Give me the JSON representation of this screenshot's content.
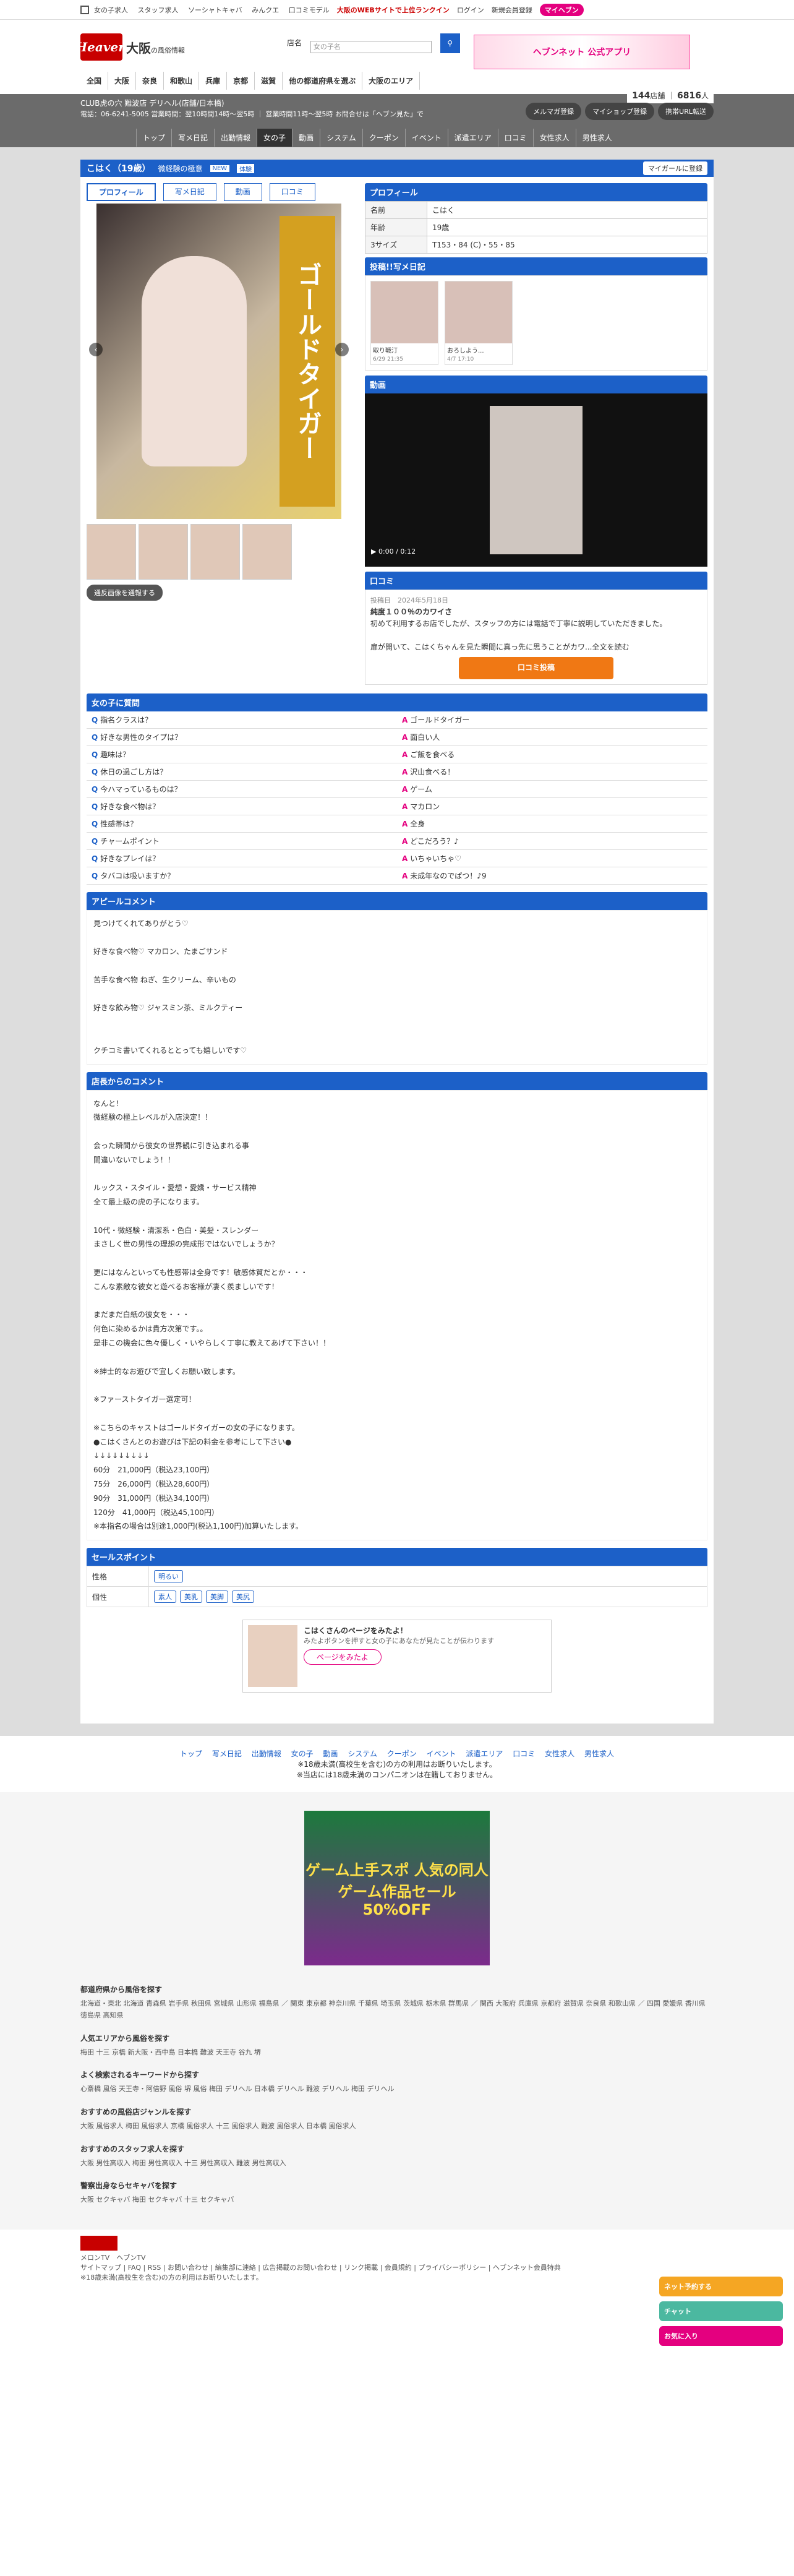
{
  "topbar": {
    "links": [
      "女の子求人",
      "スタッフ求人",
      "ソーシャトキャバ",
      "みんクエ",
      "口コミモデル"
    ],
    "right1": "大阪のWEBサイトで上位ランクイン",
    "login": "ログイン",
    "register": "新規会員登録",
    "my": "マイヘブン"
  },
  "header": {
    "logo": "Heaven",
    "pref": "大阪",
    "pref_sub": "の風俗情報",
    "search_label": "店名",
    "search_placeholder": "女の子名",
    "banner": "ヘブンネット 公式アプリ",
    "areas": [
      "全国",
      "大阪",
      "奈良",
      "和歌山",
      "兵庫",
      "京都",
      "滋賀",
      "他の都道府県を選ぶ",
      "大阪のエリア"
    ]
  },
  "shop": {
    "name": "CLUB虎の穴 難波店 デリヘル(店舗/日本橋)",
    "info": "電話：06-6241-5005 営業時間：翌10時間14時〜翌5時 ｜ 営業時間11時〜翌5時 お問合せは「ヘブン見た」で",
    "counts_a": "144",
    "counts_a_unit": "店舗",
    "counts_b": "6816",
    "counts_b_unit": "人",
    "btns": [
      "メルマガ登録",
      "マイショップ登録",
      "携帯URL転送"
    ],
    "nav": [
      "トップ",
      "写メ日記",
      "出勤情報",
      "女の子",
      "動画",
      "システム",
      "クーポン",
      "イベント",
      "派遣エリア",
      "口コミ",
      "女性求人",
      "男性求人"
    ]
  },
  "girl": {
    "title": "こはく（19歳）",
    "catch": "微経験の極意",
    "badge1": "NEW",
    "badge2": "体験",
    "fav": "マイガールに登録",
    "tabs": [
      "プロフィール",
      "写メ日記",
      "動画",
      "口コミ"
    ],
    "photo_text": "ゴールドタイガー",
    "trbtn": "通反画像を通報する"
  },
  "profile": {
    "title": "プロフィール",
    "rows": [
      [
        "名前",
        "こはく"
      ],
      [
        "年齢",
        "19歳"
      ],
      [
        "3サイズ",
        "T153・84 (C)・55・85"
      ]
    ]
  },
  "posts": {
    "title": "投稿!!写メ日記",
    "items": [
      {
        "t": "取り戦汀",
        "d": "6/29 21:35"
      },
      {
        "t": "おろしよう...",
        "d": "4/7 17:10"
      }
    ]
  },
  "video": {
    "title": "動画",
    "time": "0:00 / 0:12"
  },
  "review": {
    "title": "口コミ",
    "meta1": "投稿日",
    "meta2": "2024年5月18日",
    "head": "純度１００％のカワイさ",
    "body": "初めて利用するお店でしたが、スタッフの方には電話で丁寧に説明していただきました。\n\n扉が開いて、こはくちゃんを見た瞬間に真っ先に思うことがカワ...全文を読む",
    "btn": "口コミ投稿"
  },
  "qa": {
    "title": "女の子に質問",
    "items": [
      [
        "指名クラスは？",
        "ゴールドタイガー"
      ],
      [
        "好きな男性のタイプは？",
        "面白い人"
      ],
      [
        "趣味は？",
        "ご飯を食べる"
      ],
      [
        "休日の過ごし方は？",
        "沢山食べる！"
      ],
      [
        "今ハマっているものは？",
        "ゲーム"
      ],
      [
        "好きな食べ物は？",
        "マカロン"
      ],
      [
        "性感帯は？",
        "全身"
      ],
      [
        "チャームポイント",
        "どこだろう？♪"
      ],
      [
        "好きなプレイは？",
        "いちゃいちゃ♡"
      ],
      [
        "タバコは吸いますか？",
        "未成年なのでぱつ！♪9"
      ]
    ]
  },
  "appeal": {
    "title": "アピールコメント",
    "body": "見つけてくれてありがとう♡\n\n好きな食べ物♡ マカロン、たまごサンド\n\n苦手な食べ物 ねぎ、生クリーム、辛いもの\n\n好きな飲み物♡ ジャスミン茶、ミルクティー\n\n\nクチコミ書いてくれるととっても嬉しいです♡"
  },
  "shopcomment": {
    "title": "店長からのコメント",
    "body": "なんと！\n微経験の極上レベルが入店決定！！\n\n会った瞬間から彼女の世界観に引き込まれる事\n間違いないでしょう！！\n\nルックス・スタイル・愛想・愛嬌・サービス精神\n全て最上級の虎の子になります。\n\n10代・微経験・清潔系・色白・美髪・スレンダー\nまさしく世の男性の理想の完成形ではないでしょうか？\n\n更にはなんといっても性感帯は全身です！敏感体質だとか・・・\nこんな素敵な彼女と遊べるお客様が凄く羨ましいです！\n\nまだまだ白紙の彼女を・・・\n何色に染めるかは貴方次第です。。\n是非この機会に色々優しく・いやらしく丁寧に教えてあげて下さい！！\n\n※紳士的なお遊びで宜しくお願い致します。\n\n※ファーストタイガー選定可！\n\n※こちらのキャストはゴールドタイガーの女の子になります。\n●こはくさんとのお遊びは下記の料金を参考にして下さい●\n↓↓↓↓↓↓↓↓↓\n60分　21,000円（税込23,100円）\n75分　26,000円（税込28,600円）\n90分　31,000円（税込34,100円）\n120分　41,000円（税込45,100円）\n※本指名の場合は別途1,000円(税込1,100円)加算いたします。"
  },
  "sales": {
    "title": "セールスポイント",
    "r1": "性格",
    "r1v": [
      "明るい"
    ],
    "r2": "個性",
    "r2v": [
      "素人",
      "美乳",
      "美脚",
      "美尻"
    ]
  },
  "promo": {
    "title": "こはくさんのページをみたよ！",
    "p": "みたよボタンを押すと女の子にあなたが見たことが伝わります",
    "btn": "ページをみたよ"
  },
  "foot_nav": [
    "トップ",
    "写メ日記",
    "出勤情報",
    "女の子",
    "動画",
    "システム",
    "クーポン",
    "イベント",
    "派遣エリア",
    "口コミ",
    "女性求人",
    "男性求人"
  ],
  "notice1": "※18歳未満(高校生を含む)の方の利用はお断りいたします。",
  "notice2": "※当店には18歳未満のコンパニオンは在籍しておりません。",
  "ad": "ゲーム上手スポ 人気の同人ゲーム作品セール 50%OFF",
  "blocks": [
    {
      "h": "都道府県から風俗を探す",
      "p": "北海道・東北 北海道 青森県 岩手県 秋田県 宮城県 山形県 福島県 ／ 関東 東京都 神奈川県 千葉県 埼玉県 茨城県 栃木県 群馬県 ／ 関西 大阪府 兵庫県 京都府 滋賀県 奈良県 和歌山県 ／ 四国 愛媛県 香川県 徳島県 高知県"
    },
    {
      "h": "人気エリアから風俗を探す",
      "p": "梅田 十三 京橋 新大阪・西中島 日本橋 難波 天王寺 谷九 堺"
    },
    {
      "h": "よく検索されるキーワードから探す",
      "p": "心斎橋 風俗 天王寺・阿倍野 風俗 堺 風俗 梅田 デリヘル 日本橋 デリヘル 難波 デリヘル 梅田 デリヘル"
    },
    {
      "h": "おすすめの風俗店ジャンルを探す",
      "p": "大阪 風俗求人 梅田 風俗求人 京橋 風俗求人 十三 風俗求人 難波 風俗求人 日本橋 風俗求人"
    },
    {
      "h": "おすすめのスタッフ求人を探す",
      "p": "大阪 男性高収入 梅田 男性高収入 十三 男性高収入 難波 男性高収入"
    },
    {
      "h": "警察出身ならセキャバを探す",
      "p": "大阪 セクキャバ 梅田 セクキャバ 十三 セクキャバ"
    }
  ],
  "side": [
    "ネット予約する",
    "チャット",
    "お気に入り"
  ],
  "footer": {
    "links": "サイトマップ | FAQ | RSS | お問い合わせ | 編集部に連絡 | 広告掲載のお問い合わせ | リンク掲載 | 会員規約 | プライバシーポリシー | ヘブンネット会員特典",
    "sub": "メロンTV　ヘブンTV",
    "copy": "※18歳未満(高校生を含む)の方の利用はお断りいたします。"
  }
}
